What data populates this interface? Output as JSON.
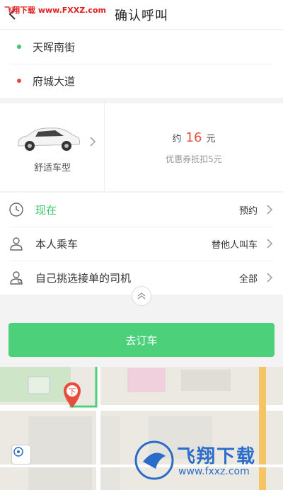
{
  "watermark_top": "飞翔下载 www.FXXZ.com",
  "header": {
    "title": "确认呼叫"
  },
  "addresses": {
    "start": "天晖南街",
    "end": "府城大道"
  },
  "car": {
    "label": "舒适车型"
  },
  "price": {
    "prefix": "约",
    "amount": "16",
    "unit": "元",
    "coupon": "优惠券抵扣5元"
  },
  "options": [
    {
      "label": "现在",
      "right": "预约"
    },
    {
      "label": "本人乘车",
      "right": "替他人叫车"
    },
    {
      "label": "自己挑选接单的司机",
      "right": "全部"
    }
  ],
  "book_button": "去订车",
  "map": {
    "marker": "下"
  },
  "watermark_bottom": {
    "text": "飞翔下载",
    "url": "www.fxxz.com"
  },
  "colors": {
    "accent_green": "#4cd07a",
    "start_dot": "#3ec86b",
    "end_dot": "#e84c3d",
    "price_red": "#e84c3d"
  }
}
